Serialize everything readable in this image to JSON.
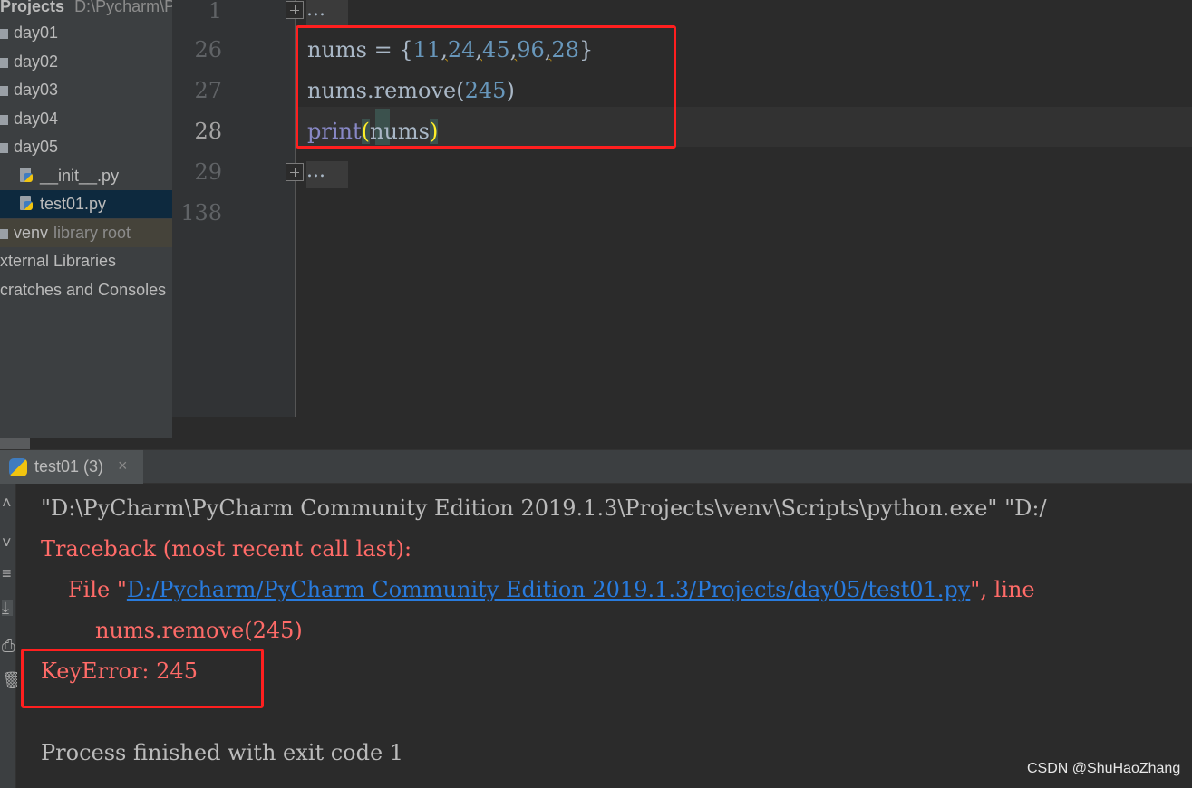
{
  "sidebar": {
    "header_label": "Projects",
    "header_path": "D:\\Pycharm\\P",
    "items": [
      {
        "label": "day01"
      },
      {
        "label": "day02"
      },
      {
        "label": "day03"
      },
      {
        "label": "day04"
      },
      {
        "label": "day05"
      },
      {
        "label": "__init__.py"
      },
      {
        "label": "test01.py"
      },
      {
        "label": "venv",
        "suffix": "library root"
      },
      {
        "label": "xternal Libraries"
      },
      {
        "label": "cratches and Consoles"
      }
    ]
  },
  "editor": {
    "line_numbers": [
      "1",
      "26",
      "27",
      "28",
      "29",
      "138"
    ],
    "fold_placeholder": "...",
    "code": {
      "var": "nums",
      "assign": " = {",
      "n1": "11",
      "n2": "24",
      "n3": "45",
      "n4": "96",
      "n5": "28",
      "close": "}",
      "comma": ",",
      "line2_prefix": "nums.remove(",
      "line2_arg": "245",
      "line2_suffix": ")",
      "line3_func": "print",
      "line3_open": "(",
      "line3_arg": "nums",
      "line3_close": ")"
    }
  },
  "run_panel": {
    "tab_label": "test01 (3)",
    "tab_close": "×",
    "lines": {
      "cmd": "\"D:\\PyCharm\\PyCharm Community Edition 2019.1.3\\Projects\\venv\\Scripts\\python.exe\" \"D:/",
      "traceback": "Traceback (most recent call last):",
      "file_prefix": "File \"",
      "file_link": "D:/Pycharm/PyCharm Community Edition 2019.1.3/Projects/day05/test01.py",
      "file_suffix": "\", line",
      "source": "nums.remove(245)",
      "error": "KeyError: 245",
      "exit": "Process finished with exit code 1"
    },
    "tool_icons": [
      "chevron-up-icon",
      "chevron-down-icon",
      "soft-wrap-icon",
      "scroll-end-icon",
      "print-icon",
      "trash-icon"
    ]
  },
  "watermark": "CSDN @ShuHaoZhang",
  "colors": {
    "highlight_box": "#ff1f1f",
    "error_text": "#ff6b68",
    "link": "#287bde",
    "number": "#6897bb",
    "builtin": "#8888c6"
  }
}
